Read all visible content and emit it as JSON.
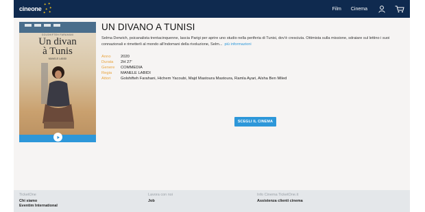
{
  "header": {
    "logo_text": "cineone",
    "nav": {
      "film": "Film",
      "cinema": "Cinema"
    },
    "icons": [
      "user-icon",
      "cart-icon"
    ]
  },
  "film": {
    "title": "UN DIVANO A TUNISI",
    "synopsis": "Selma Derwich, psicanalista trentacinquenne, lascia Parigi per aprire uno studio nella periferia di Tunisi, dov'è cresciuta. Ottimista sulla missione, sdraiare sul lettino i suoi connazionali e rimetterli al mondo all'indomani della rivoluzione, Selm...",
    "more_link": "più informazioni",
    "details": [
      {
        "label": "Anno",
        "value": "2020"
      },
      {
        "label": "Durata",
        "value": "2H 27'"
      },
      {
        "label": "Genere",
        "value": "COMMEDIA"
      },
      {
        "label": "Regia",
        "value": "MANELE LABIDI"
      },
      {
        "label": "Attori",
        "value": "Golshifteh Farahani, Hichem Yacoubi, Majd Mastoura Mastoura, Ramla Ayari, Aïsha Ben Miled"
      }
    ],
    "choose_button": "SCEGLI IL CINEMA"
  },
  "poster": {
    "actress": "GOLSHIFTEH FARAHANI",
    "title_line1": "Un divan",
    "title_line2": "à Tunis",
    "director": "MANELE LABIDI"
  },
  "footer": {
    "columns": [
      {
        "heading": "TicketOne",
        "links": [
          "Chi siamo",
          "Eventim International"
        ]
      },
      {
        "heading": "Lavora con noi",
        "links": [
          "Job"
        ]
      },
      {
        "heading": "Info Cinema TicketOne.it",
        "links": [
          "Assistenza clienti cinema"
        ]
      }
    ]
  },
  "colors": {
    "header_bg": "#0f2a4f",
    "accent": "#2d97d9",
    "label": "#e8a33d",
    "star": "#f2c21a"
  }
}
